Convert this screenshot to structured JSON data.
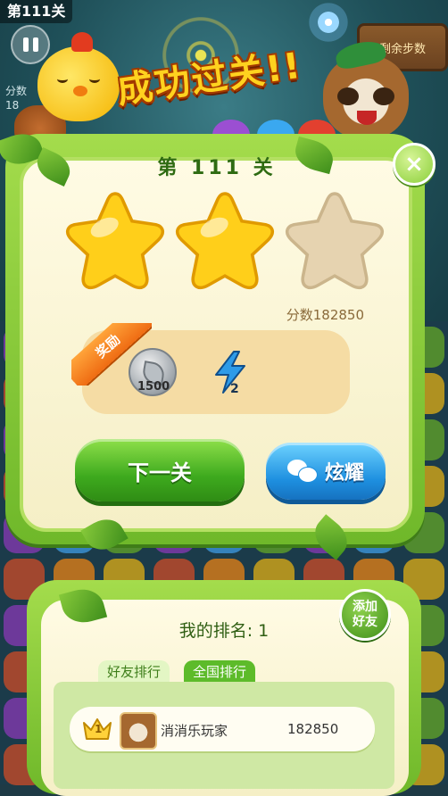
{
  "hud": {
    "level_tag": "第111关",
    "score_label": "分数",
    "score_value": "18",
    "steps_label": "剩余步数"
  },
  "banner": {
    "title": "成功过关!!"
  },
  "result_panel": {
    "level_title": "第 111 关",
    "stars_earned": 2,
    "stars_total": 3,
    "score_text": "分数182850",
    "reward_label": "奖励",
    "rewards": [
      {
        "icon": "silver-coin-icon",
        "count": "1500"
      },
      {
        "icon": "lightning-bolt-icon",
        "count": "2"
      }
    ],
    "next_button": "下一关",
    "share_button": "炫耀",
    "close_icon": "×"
  },
  "ranking": {
    "title": "我的排名: 1",
    "add_friend": [
      "添加",
      "好友"
    ],
    "tabs": [
      {
        "label": "好友排行",
        "active": true
      },
      {
        "label": "全国排行",
        "active": false
      }
    ],
    "rows": [
      {
        "rank": "1",
        "name": "消消乐玩家",
        "score": "182850"
      }
    ]
  },
  "colors": {
    "panel_green": "#8bcf3a",
    "button_green": "#3eaa1e",
    "button_blue": "#1e90e0",
    "star_gold": "#ffcf1a",
    "star_empty": "#e6d3b0"
  }
}
